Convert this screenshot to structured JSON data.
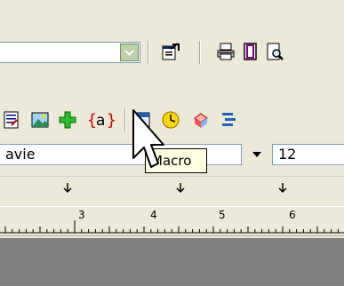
{
  "toolbar1": {
    "combo_value": "",
    "icons": [
      "dropdown-arrow-icon",
      "properties-icon",
      "print-icon",
      "page-icon",
      "print-preview-icon"
    ]
  },
  "toolbar2": {
    "icons": [
      "document-icon",
      "image-icon",
      "add-icon",
      "macro-icon",
      "calendar-icon",
      "clock-icon",
      "object-icon",
      "layout-icon"
    ]
  },
  "font": {
    "name": "avie",
    "size": "12"
  },
  "tooltip": {
    "text": "Macro"
  },
  "ruler": {
    "numbers": [
      "3",
      "4",
      "5",
      "6"
    ]
  },
  "colors": {
    "chrome": "#ece9d8",
    "workspace": "#808080",
    "tooltip_bg": "#ffffe1",
    "macro_brace": "#cc0000"
  }
}
